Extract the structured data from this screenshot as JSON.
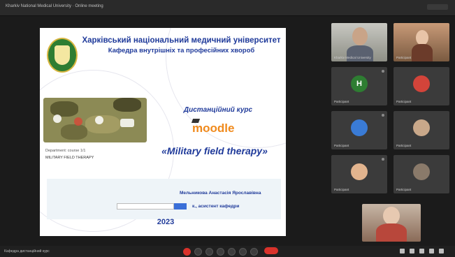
{
  "window": {
    "title": "Kharkiv National Medical University · Online meeting"
  },
  "slide": {
    "university": "Харківський національний медичний університет",
    "department": "Кафедра внутрішніх та професійних хвороб",
    "course_label": "Дистанційний курс",
    "platform": "moodle",
    "course_title": "«Military field therapy»",
    "caption_small": "Department: course 1/1",
    "caption_title": "MILITARY FIELD THERAPY",
    "author_line1": "Мельникова Анастасія Ярославівна",
    "author_line2": "к., асистент кафедри",
    "year": "2023"
  },
  "participants": [
    {
      "name": "Kharkiv Medical University"
    },
    {
      "name": "Participant"
    },
    {
      "name": "Participant",
      "initial": "H"
    },
    {
      "name": "Participant"
    },
    {
      "name": "Participant"
    },
    {
      "name": "Participant"
    },
    {
      "name": "Participant"
    },
    {
      "name": "Participant"
    }
  ],
  "bottom_bar": {
    "left_text": "Кафедра дистанційний курс"
  },
  "colors": {
    "accent_blue": "#1f3a9a",
    "moodle_orange": "#f08a1c",
    "hangup_red": "#d9322b"
  }
}
